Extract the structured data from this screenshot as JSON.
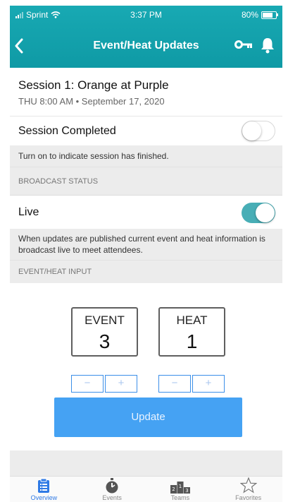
{
  "status_bar": {
    "carrier": "Sprint",
    "time": "3:37 PM",
    "battery": "80%"
  },
  "nav": {
    "back_icon": "chevron-left-icon",
    "title": "Event/Heat Updates",
    "icons": [
      "key-icon",
      "bell-icon"
    ]
  },
  "session": {
    "name": "Session 1: Orange at Purple",
    "date": "THU 8:00 AM • September 17, 2020"
  },
  "completed": {
    "label": "Session Completed",
    "on": false,
    "note": "Turn on to indicate session has finished."
  },
  "broadcast": {
    "section_label": "BROADCAST STATUS",
    "label": "Live",
    "on": true,
    "note": "When updates are published current event and heat information is broadcast live to meet attendees."
  },
  "input": {
    "section_label": "EVENT/HEAT INPUT",
    "event": {
      "label": "EVENT",
      "value": "3"
    },
    "heat": {
      "label": "HEAT",
      "value": "1"
    },
    "minus": "−",
    "plus": "+",
    "update_label": "Update"
  },
  "tabs": [
    {
      "label": "Overview",
      "icon": "clipboard-icon",
      "active": true
    },
    {
      "label": "Events",
      "icon": "stopwatch-icon",
      "active": false
    },
    {
      "label": "Teams",
      "icon": "podium-icon",
      "active": false
    },
    {
      "label": "Favorites",
      "icon": "star-icon",
      "active": false
    }
  ],
  "colors": {
    "header": "#15a2ad",
    "toggle_on": "#48aeb6",
    "accent_blue": "#45a2f3",
    "active_tab": "#2f7ae5"
  }
}
